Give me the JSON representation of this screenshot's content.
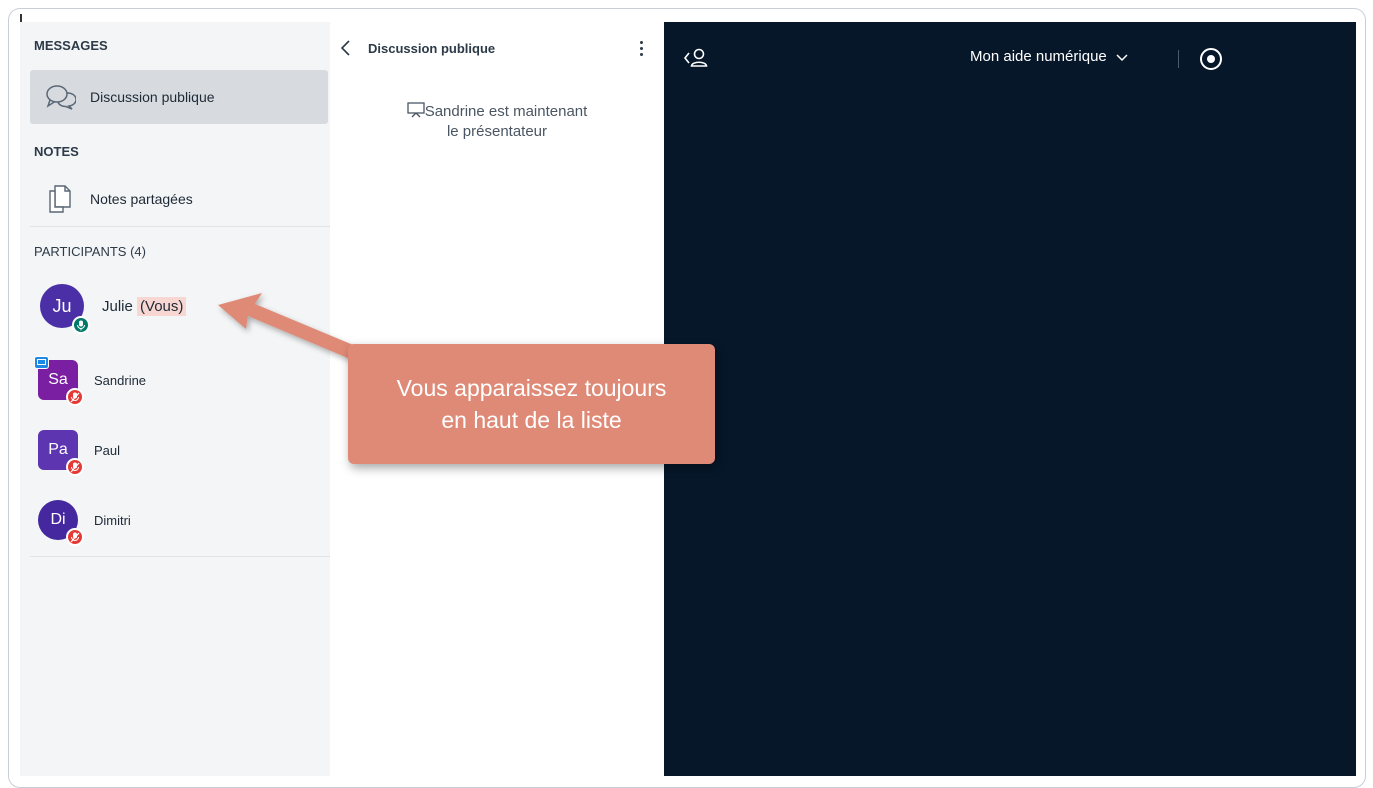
{
  "sidebar": {
    "messages_title": "MESSAGES",
    "public_chat_label": "Discussion publique",
    "notes_title": "NOTES",
    "shared_notes_label": "Notes partagées",
    "participants_title": "PARTICIPANTS (4)",
    "participants": [
      {
        "initials": "Ju",
        "name": "Julie",
        "suffix": "(Vous)",
        "avatar_color": "#4a2fa6",
        "badge": "mic-icon",
        "badge_color": "#00796b"
      },
      {
        "initials": "Sa",
        "name": "Sandrine",
        "avatar_color": "#7b1fa2",
        "badge": "mic-muted-icon",
        "badge_color": "#e53935",
        "presenter": true
      },
      {
        "initials": "Pa",
        "name": "Paul",
        "avatar_color": "#5e35b1",
        "badge": "mic-muted-icon",
        "badge_color": "#e53935"
      },
      {
        "initials": "Di",
        "name": "Dimitri",
        "avatar_color": "#4527a0",
        "badge": "mic-muted-icon",
        "badge_color": "#e53935"
      }
    ]
  },
  "chat": {
    "title": "Discussion publique",
    "system_message_line1": "Sandrine est maintenant",
    "system_message_line2": "le présentateur"
  },
  "stage": {
    "meeting_name": "Mon aide numérique",
    "background_color": "#06172a"
  },
  "callout": {
    "line1": "Vous apparaissez toujours",
    "line2": "en haut de la liste",
    "color": "#df8a76"
  }
}
